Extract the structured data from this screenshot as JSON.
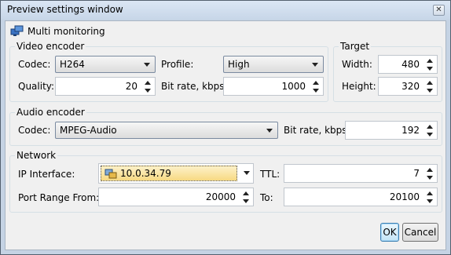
{
  "window": {
    "title": "Preview settings window",
    "close_glyph": "✕"
  },
  "header": {
    "label": "Multi monitoring",
    "icon": "monitors-icon"
  },
  "video_encoder": {
    "legend": "Video encoder",
    "codec_label": "Codec:",
    "codec_value": "H264",
    "profile_label": "Profile:",
    "profile_value": "High",
    "quality_label": "Quality:",
    "quality_value": "20",
    "bitrate_label": "Bit rate, kbps:",
    "bitrate_value": "1000"
  },
  "target": {
    "legend": "Target",
    "width_label": "Width:",
    "width_value": "480",
    "height_label": "Height:",
    "height_value": "320"
  },
  "audio_encoder": {
    "legend": "Audio encoder",
    "codec_label": "Codec:",
    "codec_value": "MPEG-Audio",
    "bitrate_label": "Bit rate, kbps:",
    "bitrate_value": "192"
  },
  "network": {
    "legend": "Network",
    "ip_label": "IP Interface:",
    "ip_value": "10.0.34.79",
    "ttl_label": "TTL:",
    "ttl_value": "7",
    "port_from_label": "Port Range From:",
    "port_from_value": "20000",
    "port_to_label": "To:",
    "port_to_value": "20100"
  },
  "buttons": {
    "ok": "OK",
    "cancel": "Cancel"
  },
  "colors": {
    "accent": "#3c7fb1",
    "selection": "#f7d982",
    "frame": "#c5d3e4"
  }
}
